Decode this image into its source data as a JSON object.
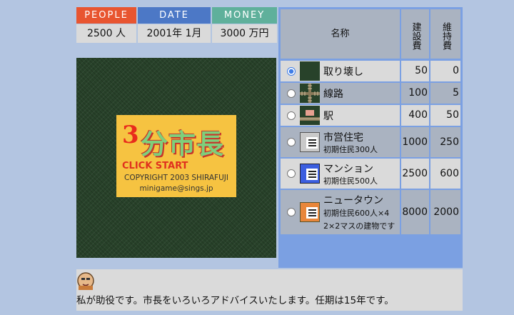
{
  "stats": {
    "people_label": "PEOPLE",
    "date_label": "DATE",
    "money_label": "MONEY",
    "people_value": "2500 人",
    "date_value": "2001年 1月",
    "money_value": "3000 万円",
    "colors": {
      "people": "#e85530",
      "date": "#4c78c6",
      "money": "#5fb09b"
    }
  },
  "title_card": {
    "logo_number": "3",
    "logo_text": "分市長",
    "click_start": "CLICK START",
    "copyright": "COPYRIGHT 2003 SHIRAFUJI",
    "email": "minigame@sings.jp"
  },
  "table": {
    "header_name": "名称",
    "header_build": "建設費",
    "header_maint": "維持費",
    "rows": [
      {
        "name": "取り壊し",
        "sub1": "",
        "sub2": "",
        "build": "50",
        "maint": "0",
        "selected": true,
        "icon": "demolish-icon"
      },
      {
        "name": "線路",
        "sub1": "",
        "sub2": "",
        "build": "100",
        "maint": "5",
        "selected": false,
        "icon": "railway-icon"
      },
      {
        "name": "駅",
        "sub1": "",
        "sub2": "",
        "build": "400",
        "maint": "50",
        "selected": false,
        "icon": "station-icon"
      },
      {
        "name": "市営住宅",
        "sub1": "初期住民300人",
        "sub2": "",
        "build": "1000",
        "maint": "250",
        "selected": false,
        "icon": "public-housing-icon"
      },
      {
        "name": "マンション",
        "sub1": "初期住民500人",
        "sub2": "",
        "build": "2500",
        "maint": "600",
        "selected": false,
        "icon": "mansion-icon"
      },
      {
        "name": "ニュータウン",
        "sub1": "初期住民600人×4",
        "sub2": "2×2マスの建物です",
        "build": "8000",
        "maint": "2000",
        "selected": false,
        "icon": "newtown-icon"
      }
    ]
  },
  "message": {
    "text": "私が助役です。市長をいろいろアドバイスいたします。任期は15年です。"
  }
}
